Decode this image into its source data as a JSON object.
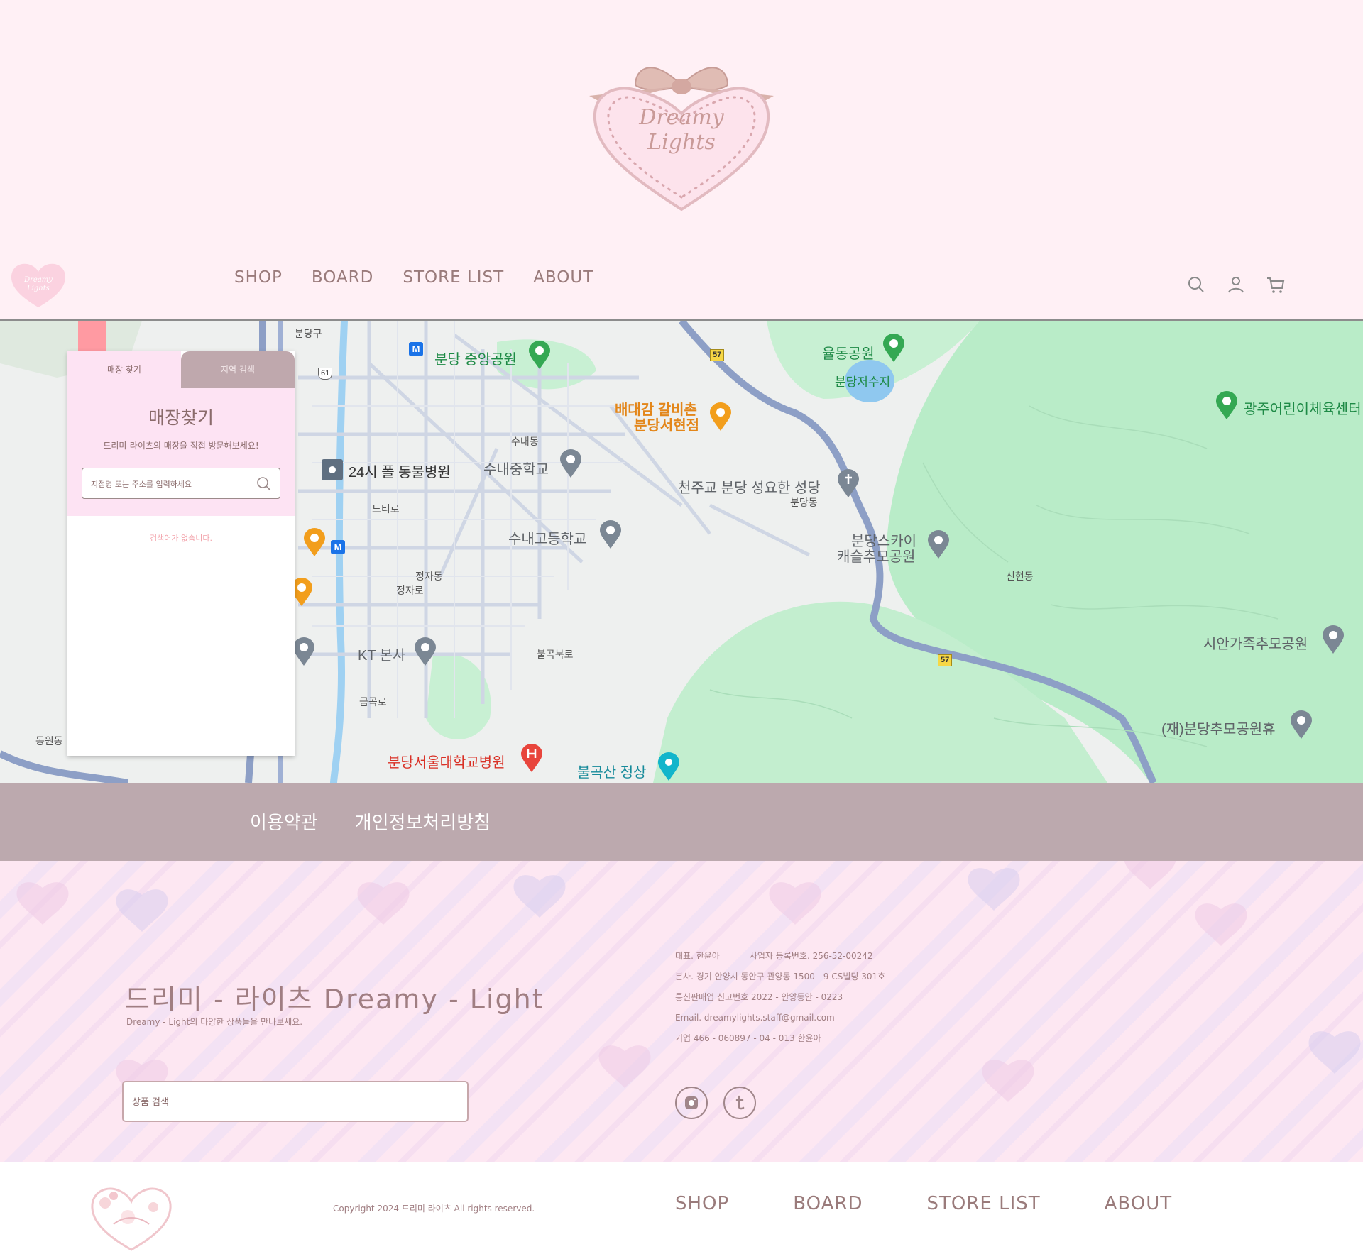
{
  "brand": {
    "logo_text_line1": "Dreamy",
    "logo_text_line2": "Lights"
  },
  "nav": {
    "items": [
      "SHOP",
      "BOARD",
      "STORE LIST",
      "ABOUT"
    ],
    "icons": [
      "search-icon",
      "user-icon",
      "cart-icon"
    ]
  },
  "store_panel": {
    "tab_find": "매장 찾기",
    "tab_region": "지역 검색",
    "title": "매장찾기",
    "description": "드리미-라이츠의 매장을 직접 방문해보세요!",
    "search_placeholder": "지점명 또는 주소를 입력하세요",
    "empty_message": "검색어가 없습니다."
  },
  "map": {
    "labels": {
      "bundang_gu": "분당구",
      "central_park": "분당 중앙공원",
      "yuldong_park": "율동공원",
      "reservoir": "분당저수지",
      "gwangju_center": "광주어린이체육센터",
      "restaurant": "배대감 갈비촌",
      "restaurant_branch": "분당서현점",
      "sunae_dong": "수내동",
      "animal_hospital": "24시 폴 동물병원",
      "sunae_middle": "수내중학교",
      "catholic_church": "천주교 분당 성요한 성당",
      "bundang_dong": "분당동",
      "neutiro": "느티로",
      "sunae_high": "수내고등학교",
      "sky_castle": "분당스카이",
      "sky_castle_2": "캐슬추모공원",
      "sinhyeon_dong": "신현동",
      "jeongja_dong": "정자동",
      "jeongjaro": "정자로",
      "sian_park": "시안가족추모공원",
      "kt_hq": "KT 본사",
      "bulgok_ro": "불곡북로",
      "geumgok_ro": "금곡로",
      "memorial_rest": "(재)분당추모공원휴",
      "dongwon_dong": "동원동",
      "snu_hospital": "분당서울대학교병원",
      "bulgoksan": "불곡산 정상",
      "route_57": "57",
      "route_61": "61",
      "metro": "M"
    }
  },
  "policy": {
    "terms": "이용약관",
    "privacy": "개인정보처리방침"
  },
  "footer": {
    "brand_title": "드리미 - 라이츠 Dreamy - Light",
    "brand_sub": "Dreamy - Light의 다양한 상품들을 만나보세요.",
    "search_placeholder": "상품 검색",
    "ceo": "대표. 한윤아",
    "biz_no": "사업자 등록번호. 256-52-00242",
    "address": "본사. 경기 안양시 동안구 관양동 1500 - 9 CS빌딩 301호",
    "ecommerce_no": "통신판매업 신고번호 2022 - 안양동안 - 0223",
    "email": "Email. dreamylights.staff@gmail.com",
    "bank": "기업 466 - 060897 - 04 - 013 한윤아",
    "social": [
      "instagram-icon",
      "tumblr-icon"
    ]
  },
  "bottom": {
    "copyright": "Copyright 2024 드리미 라이츠 All rights reserved.",
    "nav": [
      "SHOP",
      "BOARD",
      "STORE LIST",
      "ABOUT"
    ]
  },
  "colors": {
    "header_bg": "#fff0f5",
    "panel_pink": "#fde3f3",
    "tab_mauve": "#bfa8ad",
    "policy_bar": "#bca9ae",
    "text_brown": "#8a6b6b"
  }
}
